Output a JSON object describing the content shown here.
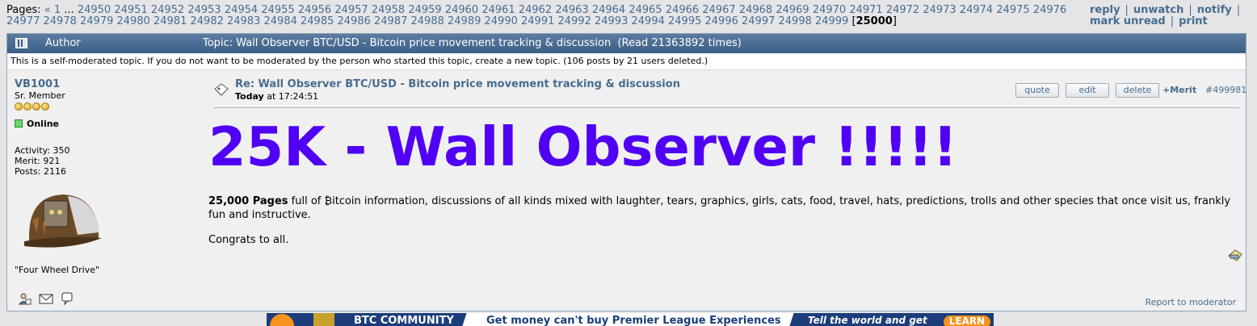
{
  "pagination": {
    "label": "Pages:",
    "prev": "«",
    "first": "1",
    "ellipsis": "...",
    "pages": [
      "24950",
      "24951",
      "24952",
      "24953",
      "24954",
      "24955",
      "24956",
      "24957",
      "24958",
      "24959",
      "24960",
      "24961",
      "24962",
      "24963",
      "24964",
      "24965",
      "24966",
      "24967",
      "24968",
      "24969",
      "24970",
      "24971",
      "24972",
      "24973",
      "24974",
      "24975",
      "24976",
      "24977",
      "24978",
      "24979",
      "24980",
      "24981",
      "24982",
      "24983",
      "24984",
      "24985",
      "24986",
      "24987",
      "24988",
      "24989",
      "24990",
      "24991",
      "24992",
      "24993",
      "24994",
      "24995",
      "24996",
      "24997",
      "24998",
      "24999"
    ],
    "current": "25000"
  },
  "actions": [
    "reply",
    "unwatch",
    "notify",
    "mark unread",
    "print"
  ],
  "header": {
    "author_label": "Author",
    "topic_label": "Topic: Wall Observer BTC/USD - Bitcoin price movement tracking & discussion  (Read 21363892 times)"
  },
  "notice": "This is a self-moderated topic. If you do not want to be moderated by the person who started this topic, create a new topic. (106 posts by 21 users deleted.)",
  "poster": {
    "name": "VB1001",
    "rank": "Sr. Member",
    "stars": 4,
    "status": "Online",
    "activity": "Activity: 350",
    "merit": "Merit: 921",
    "posts": "Posts: 2116",
    "personal_text": "\"Four Wheel Drive\""
  },
  "post": {
    "title": "Re: Wall Observer BTC/USD - Bitcoin price movement tracking & discussion",
    "date_day": "Today",
    "date_rest": " at 17:24:51",
    "quote_label": "quote",
    "edit_label": "edit",
    "delete_label": "delete",
    "merit_label": "+Merit",
    "number": "#499981",
    "headline": "25K - Wall Observer !!!!!",
    "body_bold": "25,000 Pages",
    "body_text": " full of ₿itcoin information, discussions of all kinds mixed with laughter, tears, graphics, girls, cats, food, travel, hats, predictions, trolls and other species that once visit us, frankly fun and instructive.",
    "closing": "Congrats to all.",
    "report_label": "Report to moderator"
  },
  "banner": {
    "left_text": "BTC COMMUNITY",
    "mid_text": "Get money can't buy Premier League Experiences",
    "right_text": "Tell the world and get",
    "button": "LEARN"
  },
  "colors": {
    "link": "#476c8e",
    "headline": "#5000f5",
    "header_bg": "#4a6b93"
  }
}
